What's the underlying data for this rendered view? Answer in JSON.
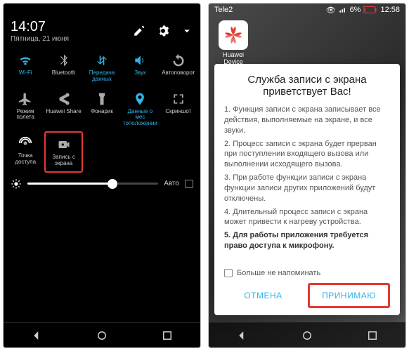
{
  "left": {
    "time": "14:07",
    "date": "Пятница, 21 июня",
    "tiles": [
      {
        "label": "Wi-Fi",
        "active": true,
        "icon": "wifi"
      },
      {
        "label": "Bluetooth",
        "active": false,
        "icon": "bluetooth"
      },
      {
        "label": "Передача данных",
        "active": true,
        "icon": "data"
      },
      {
        "label": "Звук",
        "active": true,
        "icon": "sound"
      },
      {
        "label": "Автоповорот",
        "active": false,
        "icon": "rotate"
      },
      {
        "label": "Режим полета",
        "active": false,
        "icon": "airplane"
      },
      {
        "label": "Huawei Share",
        "active": false,
        "icon": "share"
      },
      {
        "label": "Фонарик",
        "active": false,
        "icon": "flashlight"
      },
      {
        "label": "Данные о мес тоположении",
        "active": true,
        "icon": "location"
      },
      {
        "label": "Скриншот",
        "active": false,
        "icon": "screenshot"
      },
      {
        "label": "Точка доступа",
        "active": false,
        "icon": "hotspot"
      },
      {
        "label": "Запись с экрана",
        "active": false,
        "icon": "record",
        "highlight": true
      }
    ],
    "brightness": {
      "auto": "Авто"
    }
  },
  "right": {
    "carrier": "Tele2",
    "battery": "6%",
    "clock": "12:58",
    "app": {
      "label": "Huawei Device"
    },
    "dialog": {
      "title": "Служба записи с экрана приветствует Вас!",
      "paras": [
        "1. Функция записи с экрана записывает все действия, выполняемые на экране, и все звуки.",
        "2. Процесс записи с экрана будет прерван при поступлении входящего вызова или выполнении исходящего вызова.",
        "3. При работе функции записи с экрана функции записи других приложений будут отключены.",
        "4. Длительный процесс записи с экрана может привести к нагреву устройства."
      ],
      "bold": "5. Для работы приложения требуется право доступа к микрофону.",
      "dont_remind": "Больше не напоминать",
      "cancel": "ОТМЕНА",
      "accept": "ПРИНИМАЮ"
    }
  }
}
